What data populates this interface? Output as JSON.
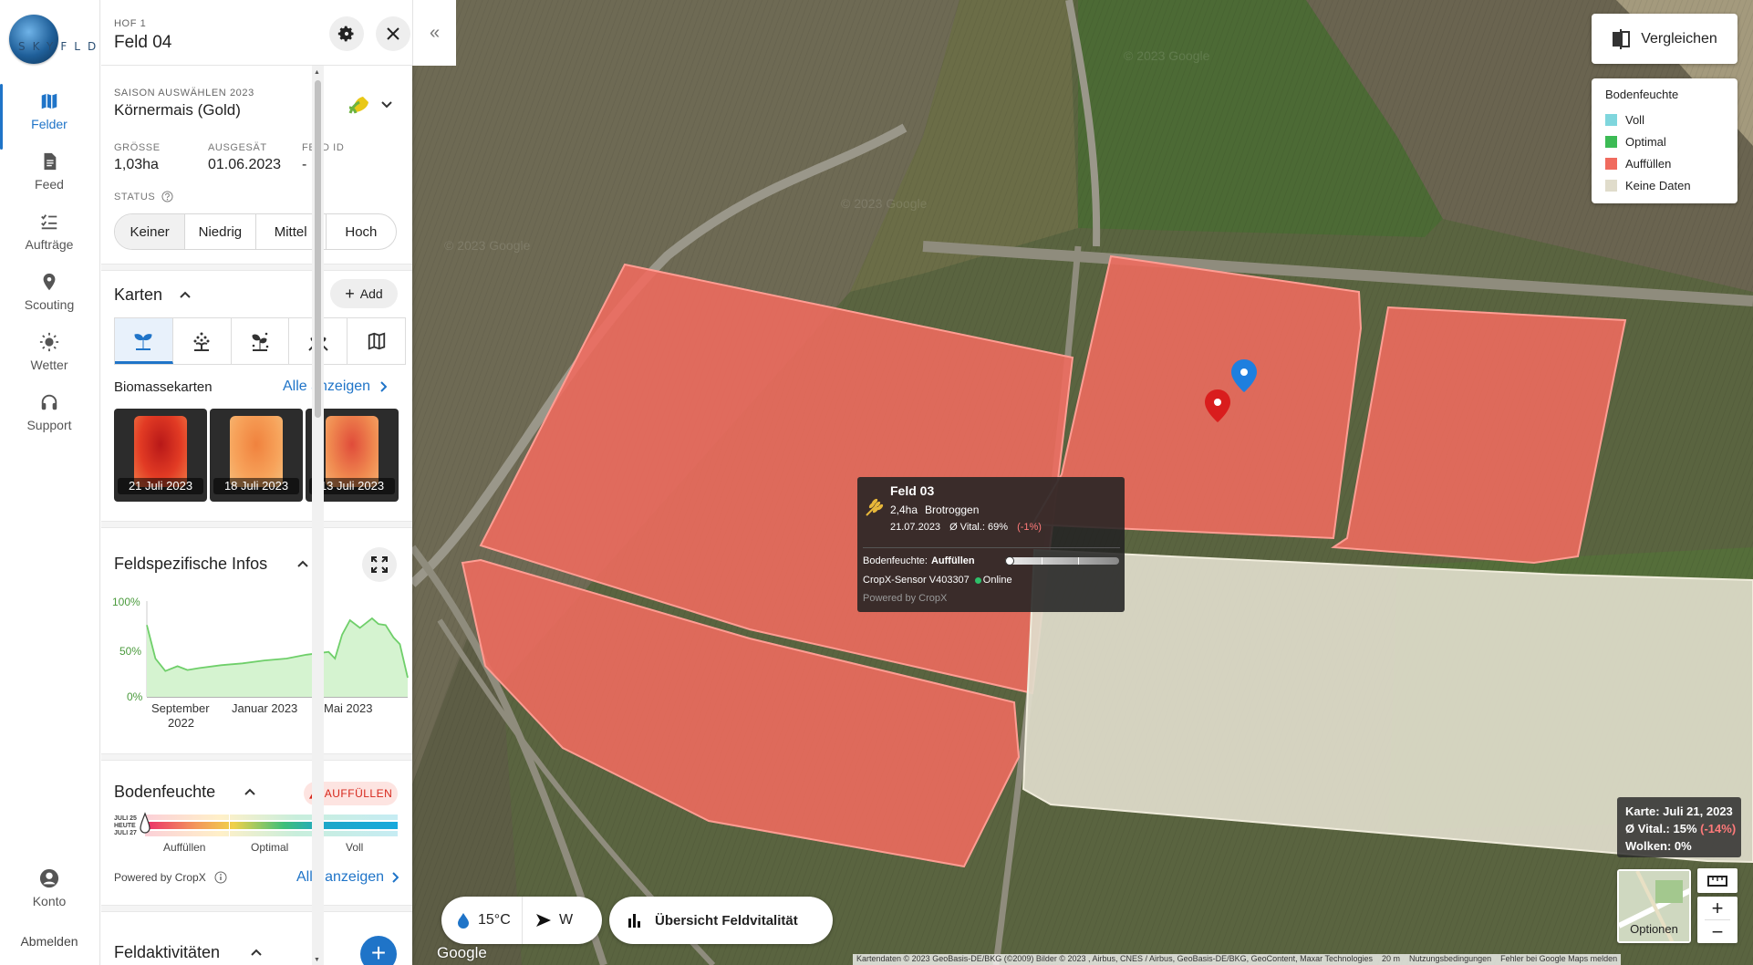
{
  "nav": {
    "logo_text": "SKYFLD",
    "items": [
      {
        "label": "Felder",
        "icon": "map-icon"
      },
      {
        "label": "Feed",
        "icon": "document-icon"
      },
      {
        "label": "Aufträge",
        "icon": "checklist-icon"
      },
      {
        "label": "Scouting",
        "icon": "location-pin-icon"
      },
      {
        "label": "Wetter",
        "icon": "sun-icon"
      },
      {
        "label": "Support",
        "icon": "headset-icon"
      }
    ],
    "account_label": "Konto",
    "logout_label": "Abmelden"
  },
  "header": {
    "farm": "HOF 1",
    "field_name": "Feld 04"
  },
  "season": {
    "label": "SAISON AUSWÄHLEN 2023",
    "crop": "Körnermais (Gold)"
  },
  "details": [
    {
      "label": "GRÖSSE",
      "value": "1,03ha"
    },
    {
      "label": "AUSGESÄT",
      "value": "01.06.2023"
    },
    {
      "label": "FELD ID",
      "value": "-"
    }
  ],
  "status": {
    "label": "STATUS",
    "options": [
      "Keiner",
      "Niedrig",
      "Mittel",
      "Hoch"
    ],
    "selected": "Keiner"
  },
  "maps": {
    "title": "Karten",
    "add_label": "Add",
    "tab_icons": [
      "plant-icon",
      "seeding-icon",
      "fertilizer-icon",
      "harvest-icon",
      "field-map-icon"
    ],
    "subtitle": "Biomassekarten",
    "show_all": "Alle anzeigen",
    "thumbnails": [
      {
        "date": "21 Juli 2023"
      },
      {
        "date": "18 Juli 2023"
      },
      {
        "date": "13 Juli 2023"
      }
    ]
  },
  "infos": {
    "title": "Feldspezifische Infos",
    "chart_data": {
      "type": "area",
      "title": "",
      "y_ticks": [
        "100%",
        "50%",
        "0%"
      ],
      "x_ticks": [
        "September 2022",
        "Januar 2023",
        "Mai 2023"
      ],
      "ylim": [
        0,
        100
      ],
      "x": [
        "2022-07-20",
        "2022-08-01",
        "2022-08-15",
        "2022-09-01",
        "2022-09-15",
        "2022-10-01",
        "2022-11-01",
        "2022-12-01",
        "2023-01-01",
        "2023-02-01",
        "2023-03-01",
        "2023-04-01",
        "2023-04-10",
        "2023-04-20",
        "2023-05-01",
        "2023-05-15",
        "2023-06-01",
        "2023-06-10",
        "2023-06-20",
        "2023-07-01",
        "2023-07-10",
        "2023-07-21"
      ],
      "values": [
        75,
        40,
        27,
        32,
        28,
        30,
        33,
        35,
        38,
        40,
        44,
        47,
        40,
        65,
        80,
        72,
        82,
        76,
        75,
        62,
        55,
        20
      ],
      "color": "#6fcf6a",
      "fill": "#d5f3d0"
    }
  },
  "moisture": {
    "title": "Bodenfeuchte",
    "badge": "AUFFÜLLEN",
    "dates": [
      "JULI 25",
      "HEUTE",
      "JULI 27"
    ],
    "scale_labels": [
      "Auffüllen",
      "Optimal",
      "Voll"
    ],
    "powered_by": "Powered by CropX",
    "show_all": "Alle anzeigen"
  },
  "activities": {
    "title": "Feldaktivitäten"
  },
  "map": {
    "compare_label": "Vergleichen",
    "legend": {
      "title": "Bodenfeuchte",
      "items": [
        {
          "label": "Voll",
          "color": "#7fd6dd"
        },
        {
          "label": "Optimal",
          "color": "#3cbb55"
        },
        {
          "label": "Auffüllen",
          "color": "#f06b5e"
        },
        {
          "label": "Keine Daten",
          "color": "#e0dccb"
        }
      ]
    },
    "popup": {
      "title": "Feld 03",
      "size": "2,4ha",
      "crop": "Brotroggen",
      "date": "21.07.2023",
      "vital": "Ø Vital.: 69%",
      "change": "(-1%)",
      "moisture_label": "Bodenfeuchte:",
      "moisture_value": "Auffüllen",
      "sensor": "CropX-Sensor V403307",
      "online": "Online",
      "powered": "Powered by CropX"
    },
    "info": {
      "karte": "Karte: Juli 21, 2023",
      "vital": "Ø Vital.: 15%",
      "vital_change": "(-14%)",
      "wolken": "Wolken: 0%"
    },
    "weather": {
      "temp": "15°C",
      "wind": "W"
    },
    "vitality_button": "Übersicht Feldvitalität",
    "options_label": "Optionen",
    "watermarks": [
      "© 2023 Google",
      "© 2023 Google",
      "© 2023 Google"
    ],
    "google_logo": "Google",
    "attribution": [
      "Kartendaten © 2023 GeoBasis-DE/BKG (©2009) Bilder © 2023 , Airbus, CNES / Airbus, GeoBasis-DE/BKG, GeoContent, Maxar Technologies",
      "20 m",
      "Nutzungsbedingungen",
      "Fehler bei Google Maps melden"
    ]
  }
}
